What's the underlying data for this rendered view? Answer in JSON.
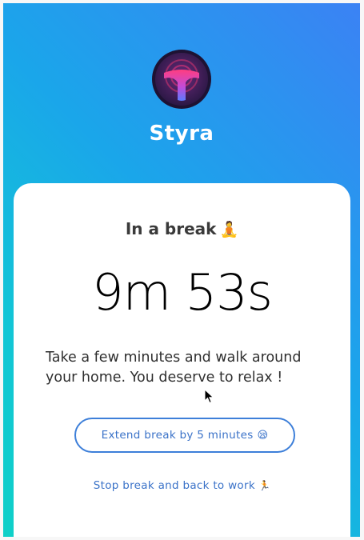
{
  "app": {
    "name": "Styra"
  },
  "break_card": {
    "title": "In a break",
    "title_emoji": "🧘",
    "timer": "9m 53s",
    "message": "Take a few minutes and walk around your home. You deserve to relax !",
    "extend_label": "Extend break by 5 minutes",
    "extend_emoji": "😪",
    "stop_label": "Stop break and back to work",
    "stop_emoji": "🏃"
  },
  "colors": {
    "gradient_top": "#3b82f4",
    "gradient_bottom": "#0fd0c8",
    "accent": "#3d7fd9",
    "logo_ring": "#2a1a4a",
    "logo_pink": "#e8357a",
    "logo_blue": "#6b7dff"
  },
  "icons": {
    "logo": "styra-logo-icon",
    "cursor": "mouse-cursor-icon"
  }
}
